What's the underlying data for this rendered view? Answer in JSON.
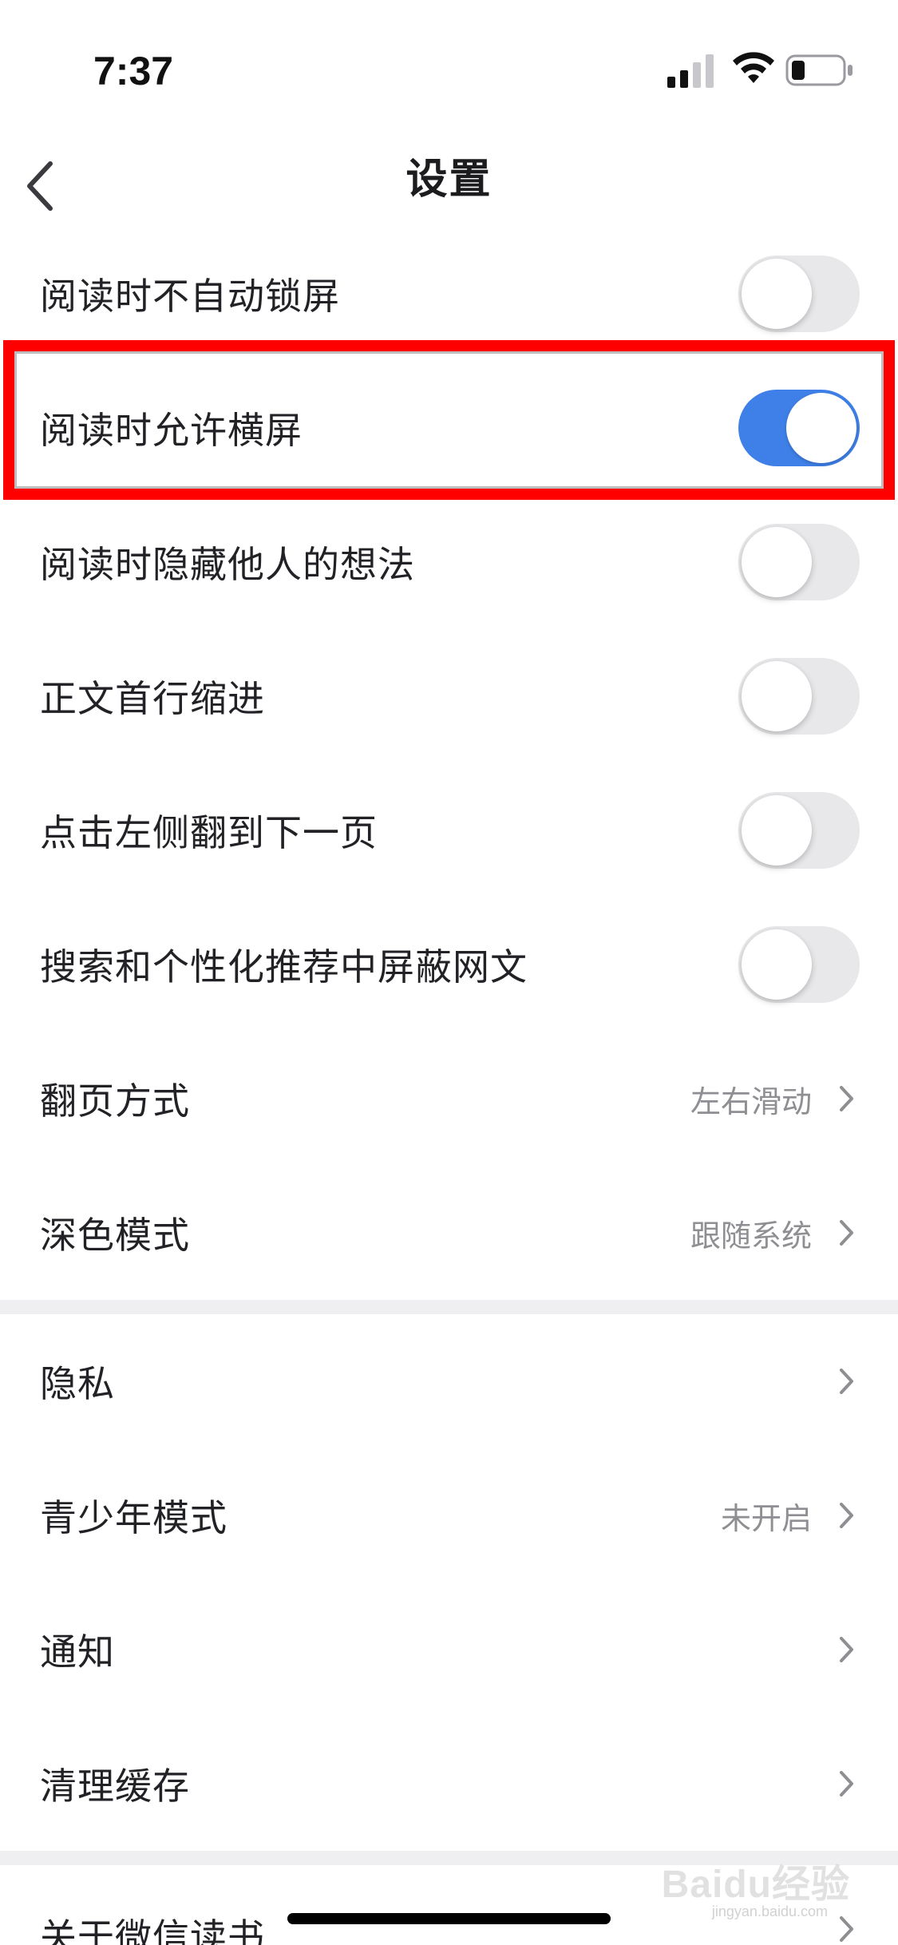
{
  "status_bar": {
    "time": "7:37",
    "signal_icon": "cellular-signal-icon",
    "wifi_icon": "wifi-icon",
    "battery_icon": "battery-low-icon"
  },
  "nav": {
    "title": "设置",
    "back_icon": "chevron-left-icon"
  },
  "toggle_rows": [
    {
      "label": "阅读时不自动锁屏",
      "on": false
    },
    {
      "label": "阅读时允许横屏",
      "on": true
    },
    {
      "label": "阅读时隐藏他人的想法",
      "on": false
    },
    {
      "label": "正文首行缩进",
      "on": false
    },
    {
      "label": "点击左侧翻到下一页",
      "on": false
    },
    {
      "label": "搜索和个性化推荐中屏蔽网文",
      "on": false
    }
  ],
  "value_rows": [
    {
      "label": "翻页方式",
      "value": "左右滑动"
    },
    {
      "label": "深色模式",
      "value": "跟随系统"
    }
  ],
  "section2_rows": [
    {
      "label": "隐私",
      "value": ""
    },
    {
      "label": "青少年模式",
      "value": "未开启"
    },
    {
      "label": "通知",
      "value": ""
    },
    {
      "label": "清理缓存",
      "value": ""
    }
  ],
  "section3_rows": [
    {
      "label": "关于微信读书",
      "value": ""
    }
  ],
  "colors": {
    "toggle_on": "#3f80e8",
    "toggle_off": "#e8e8ea",
    "highlight": "#ff0000",
    "secondary_text": "#8e8e93"
  },
  "watermark": {
    "text": "Baidu经验",
    "sub": "jingyan.baidu.com"
  }
}
